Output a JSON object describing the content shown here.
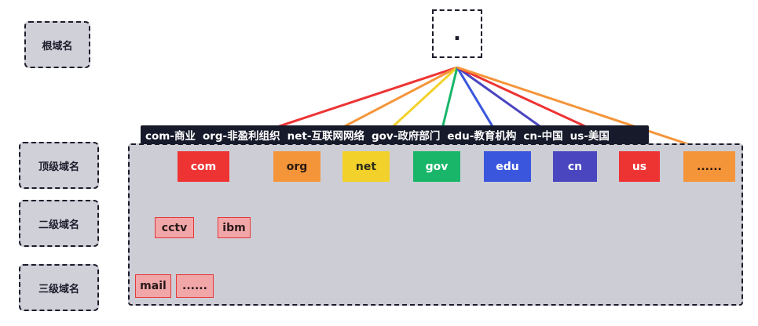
{
  "levels": {
    "root": "根域名",
    "tld": "顶级域名",
    "second": "二级域名",
    "third": "三级域名"
  },
  "root_label": ".",
  "legend": [
    "com-商业",
    "org-非盈利组织",
    "net-互联网网络",
    "gov-政府部门",
    "edu-教育机构",
    "cn-中国",
    "us-美国"
  ],
  "tlds": [
    {
      "label": "com",
      "color": "#ee3333"
    },
    {
      "label": "org",
      "color": "#f5953a"
    },
    {
      "label": "net",
      "color": "#f2d22a"
    },
    {
      "label": "gov",
      "color": "#19b66a"
    },
    {
      "label": "edu",
      "color": "#3a56dd"
    },
    {
      "label": "cn",
      "color": "#4a46c0"
    },
    {
      "label": "us",
      "color": "#ee3333"
    },
    {
      "label": "......",
      "color": "#f5953a"
    }
  ],
  "second_level": [
    "cctv",
    "ibm"
  ],
  "third_level": [
    "mail",
    "......"
  ]
}
